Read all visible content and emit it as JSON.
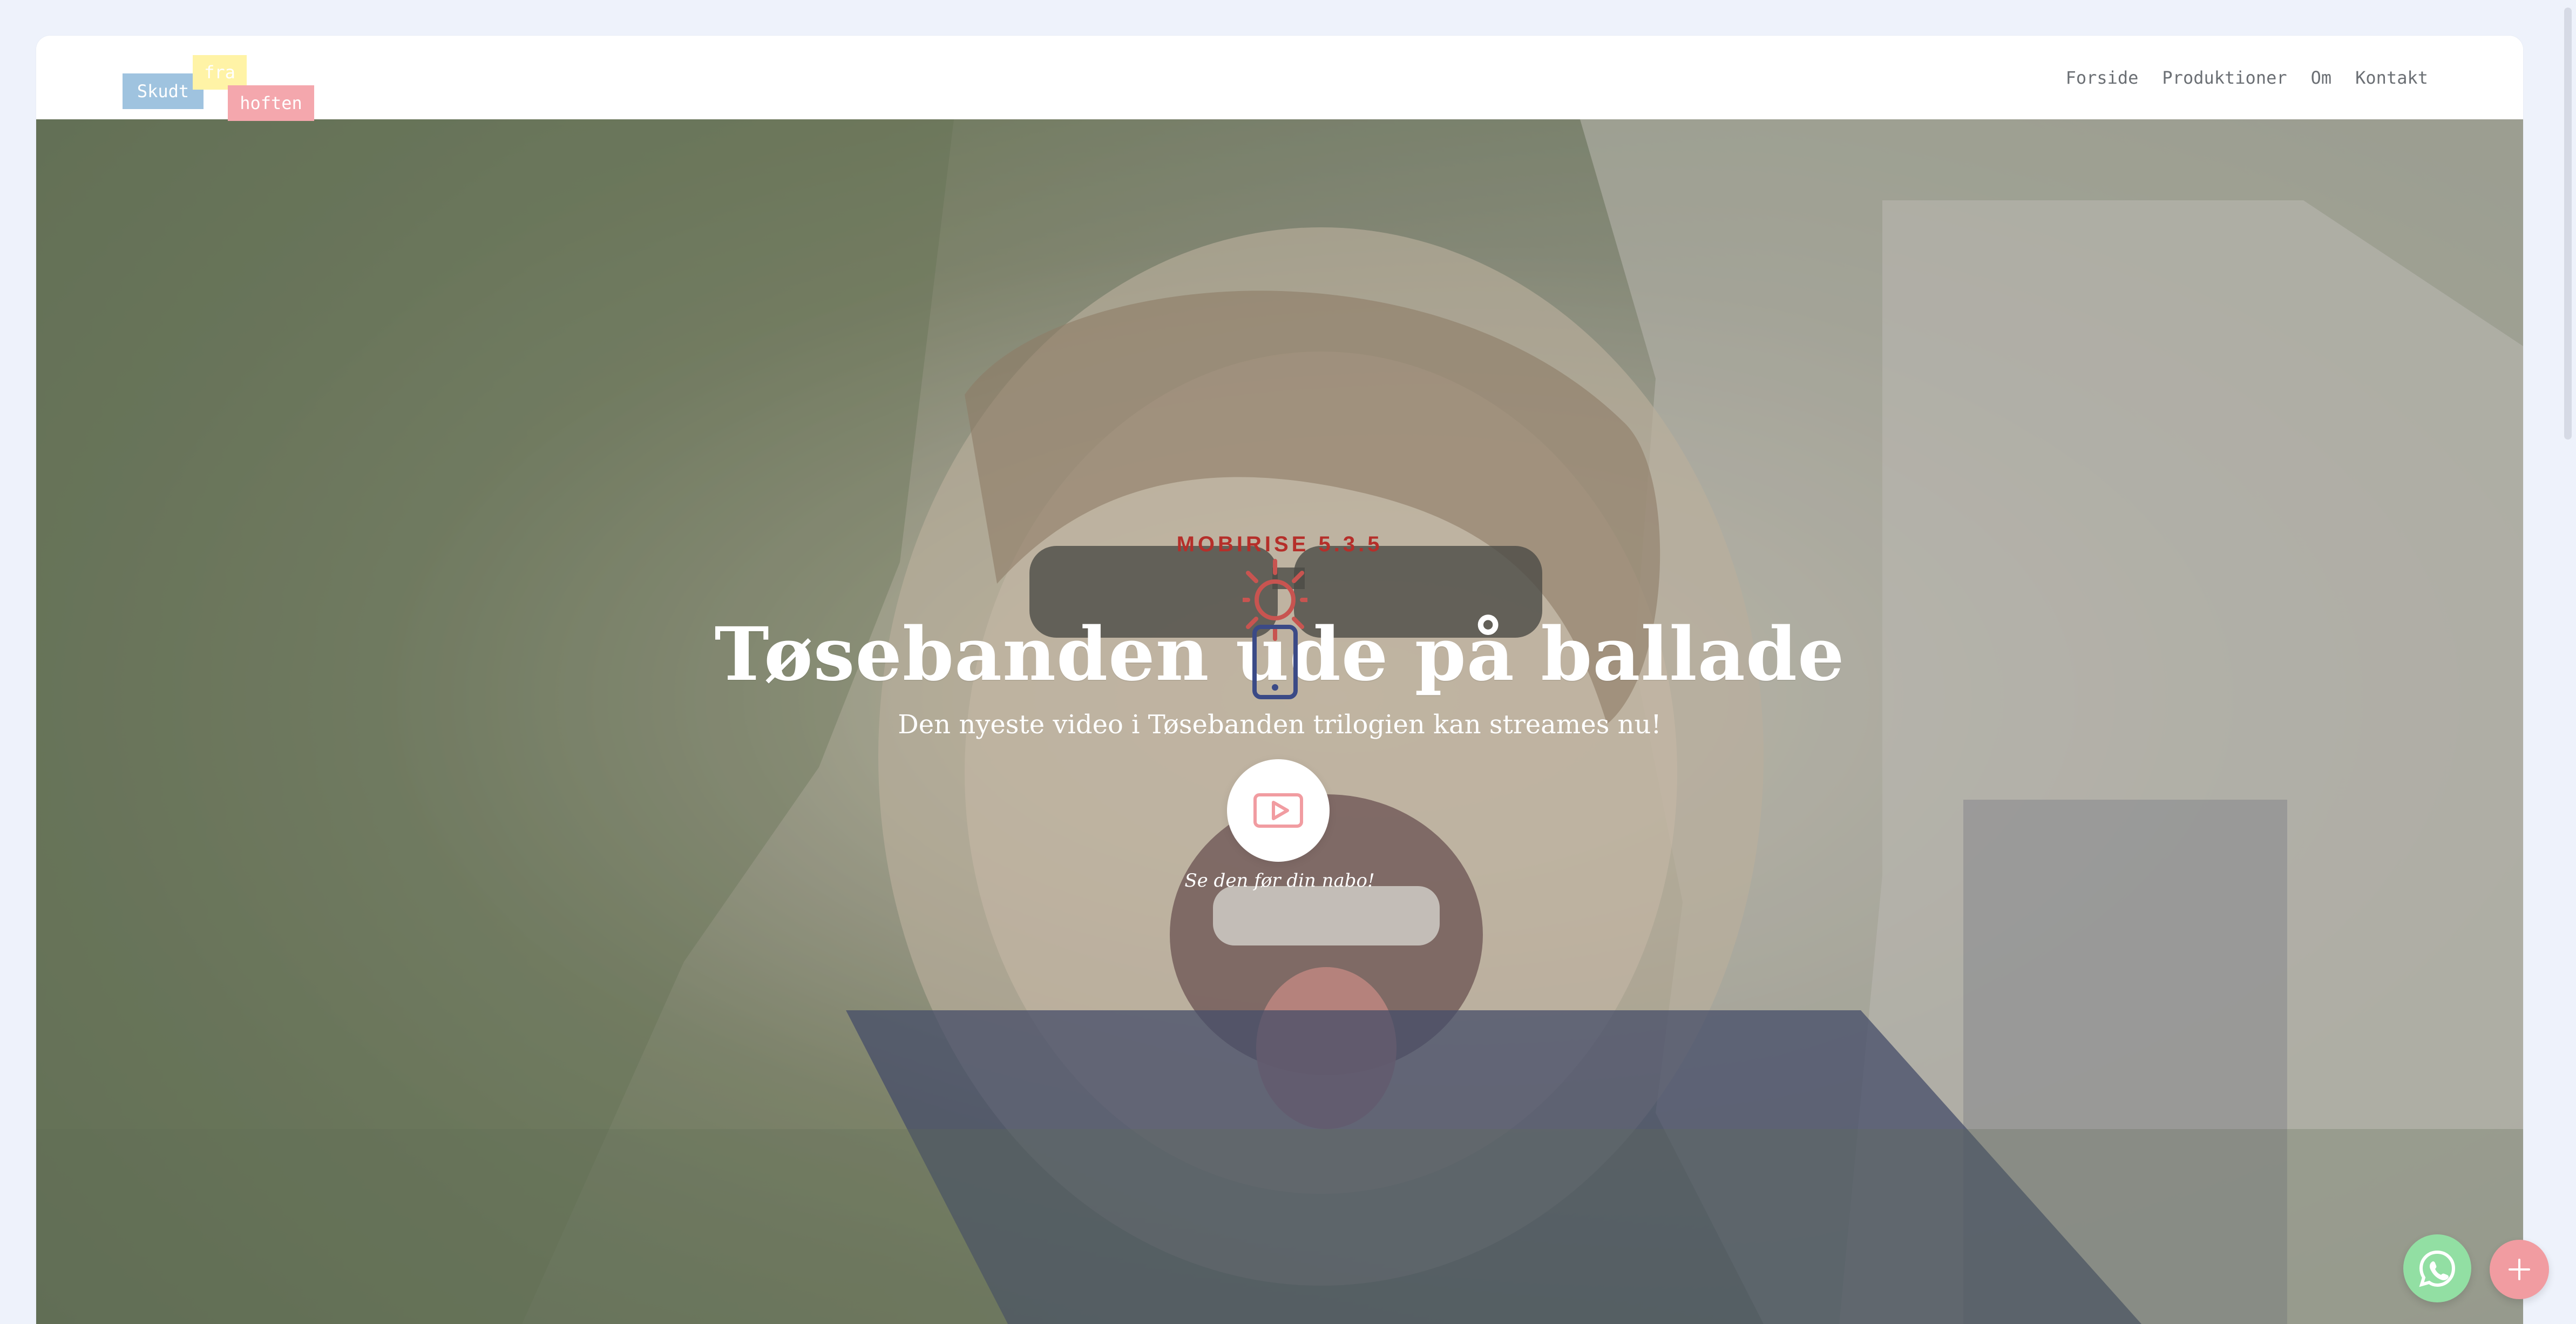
{
  "brand": {
    "word1": "Skudt",
    "word2": "fra",
    "word3": "hoften"
  },
  "nav": {
    "items": [
      {
        "label": "Forside"
      },
      {
        "label": "Produktioner"
      },
      {
        "label": "Om"
      },
      {
        "label": "Kontakt"
      }
    ]
  },
  "hero": {
    "kicker": "MOBIRISE 5.3.5",
    "title": "Tøsebanden ude på ballade",
    "subtitle": "Den nyeste video i Tøsebanden trilogien kan streames nu!",
    "cta_caption": "Se den før din nabo!"
  },
  "icons": {
    "play": "play-icon",
    "whatsapp": "whatsapp-icon",
    "plus": "plus-icon",
    "loader_sun": "sun-icon",
    "loader_phone": "phone-icon"
  },
  "colors": {
    "tag_blue": "#9fc3df",
    "tag_yellow": "#fff3a6",
    "tag_pink": "#f4a7ad",
    "accent": "#f19ca1",
    "whatsapp": "#92dfa3"
  }
}
